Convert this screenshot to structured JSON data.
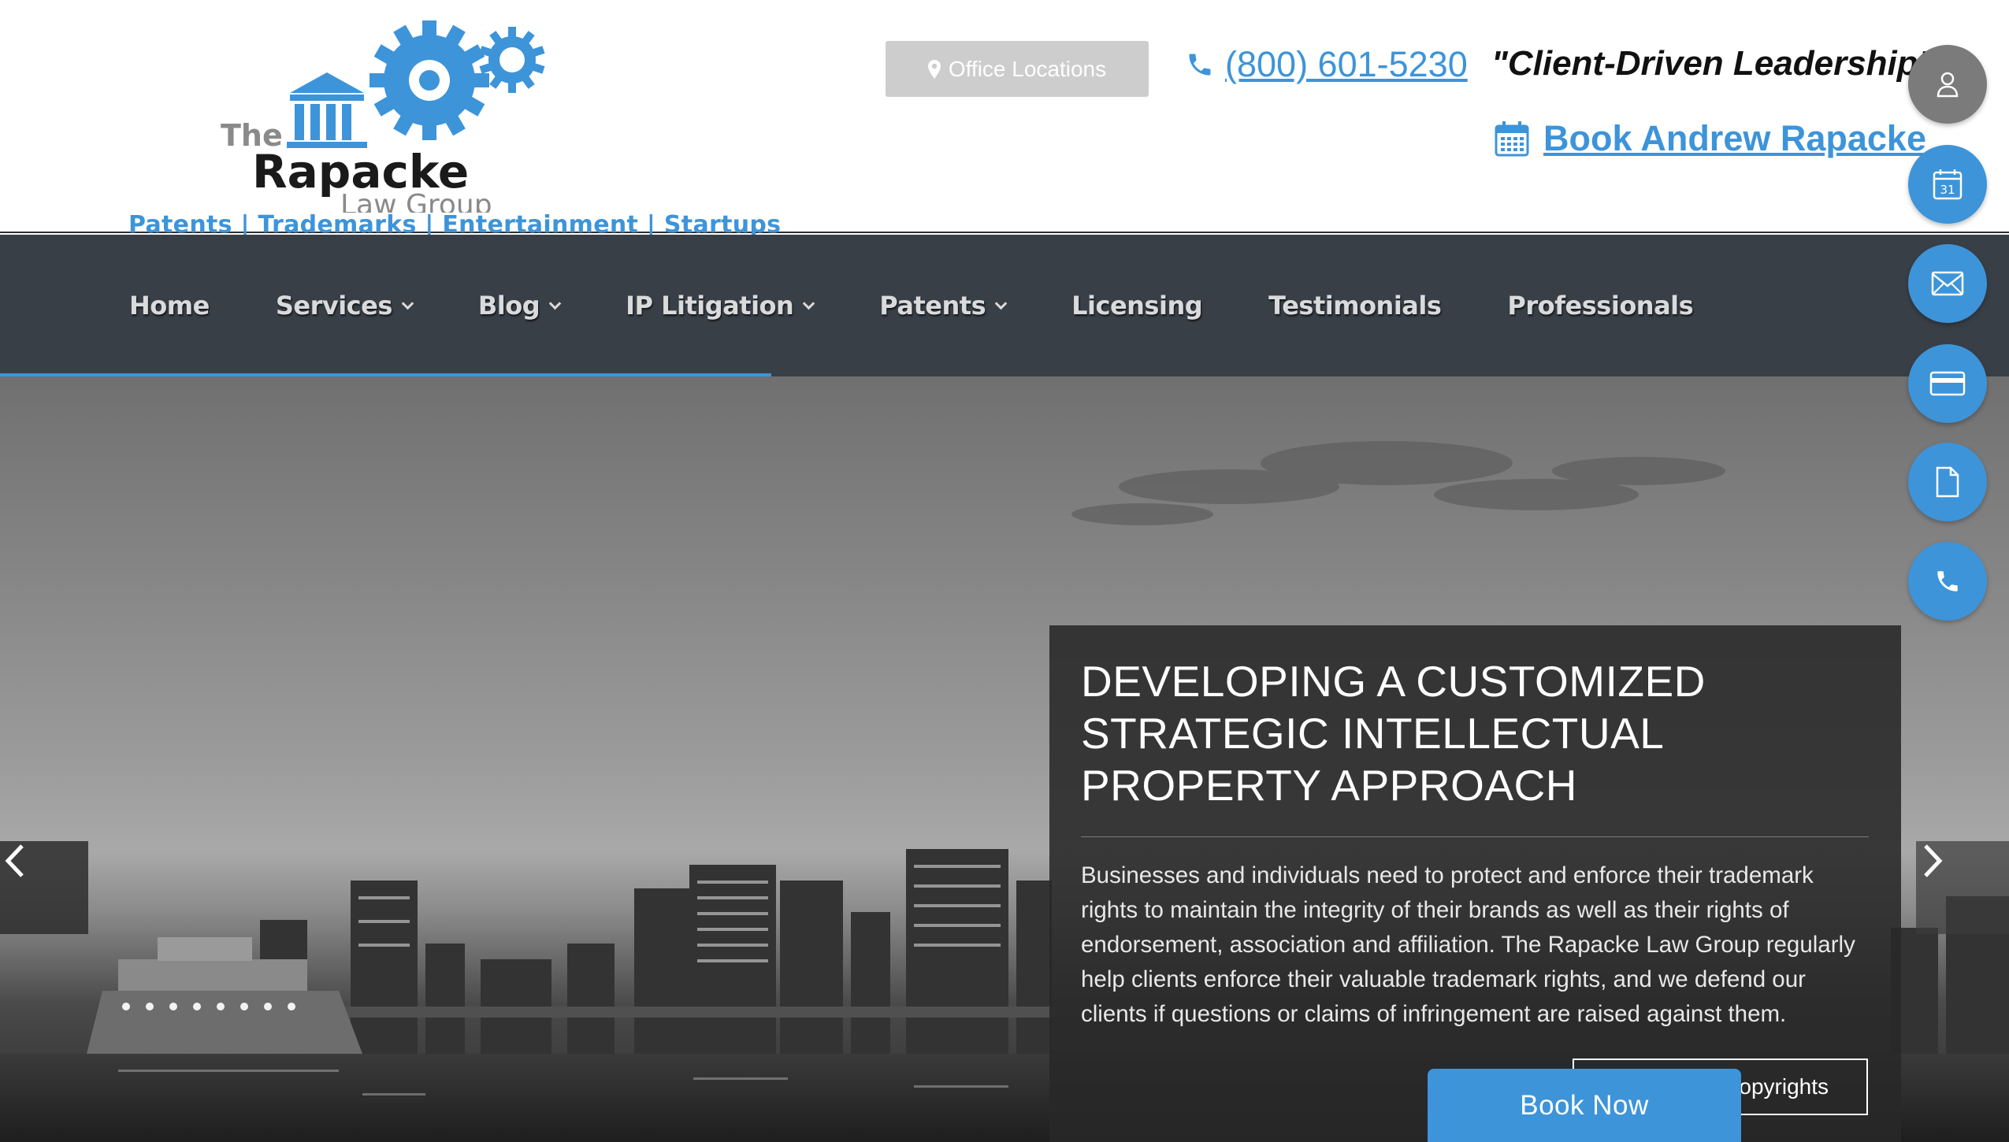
{
  "header": {
    "logo": {
      "the": "The",
      "name": "Rapacke",
      "subname": "Law Group",
      "tagline": "Patents | Trademarks | Entertainment | Startups"
    },
    "office_button_label": "Office Locations",
    "phone": "(800) 601-5230",
    "slogan": "\"Client-Driven Leadership\"",
    "book_link": "Book Andrew Rapacke"
  },
  "nav": {
    "items": [
      {
        "label": "Home",
        "has_dropdown": false
      },
      {
        "label": "Services",
        "has_dropdown": true
      },
      {
        "label": "Blog",
        "has_dropdown": true
      },
      {
        "label": "IP Litigation",
        "has_dropdown": true
      },
      {
        "label": "Patents",
        "has_dropdown": true
      },
      {
        "label": "Licensing",
        "has_dropdown": false
      },
      {
        "label": "Testimonials",
        "has_dropdown": false
      },
      {
        "label": "Professionals",
        "has_dropdown": false
      }
    ],
    "progress_fraction": 0.384
  },
  "hero": {
    "title": "DEVELOPING A CUSTOMIZED STRATEGIC INTELLECTUAL PROPERTY APPROACH",
    "body": "Businesses and individuals need to protect and enforce their trademark rights to maintain the integrity of their brands as well as their rights of endorsement, association and affiliation. The Rapacke Law Group regularly help clients enforce their valuable trademark rights, and we defend our clients if questions or claims of infringement are raised against them.",
    "secondary_button": "opyrights",
    "book_now": "Book Now",
    "prev_icon": "chevron-left-icon",
    "next_icon": "chevron-right-icon"
  },
  "floating_actions": [
    {
      "name": "user-icon"
    },
    {
      "name": "calendar-icon",
      "text": "31"
    },
    {
      "name": "mail-icon"
    },
    {
      "name": "credit-card-icon"
    },
    {
      "name": "document-icon"
    },
    {
      "name": "phone-icon"
    }
  ],
  "colors": {
    "brand_blue": "#3d94d9",
    "nav_background": "#393f47",
    "office_button": "#cdcdcd",
    "user_fab": "#7b7b7b"
  }
}
